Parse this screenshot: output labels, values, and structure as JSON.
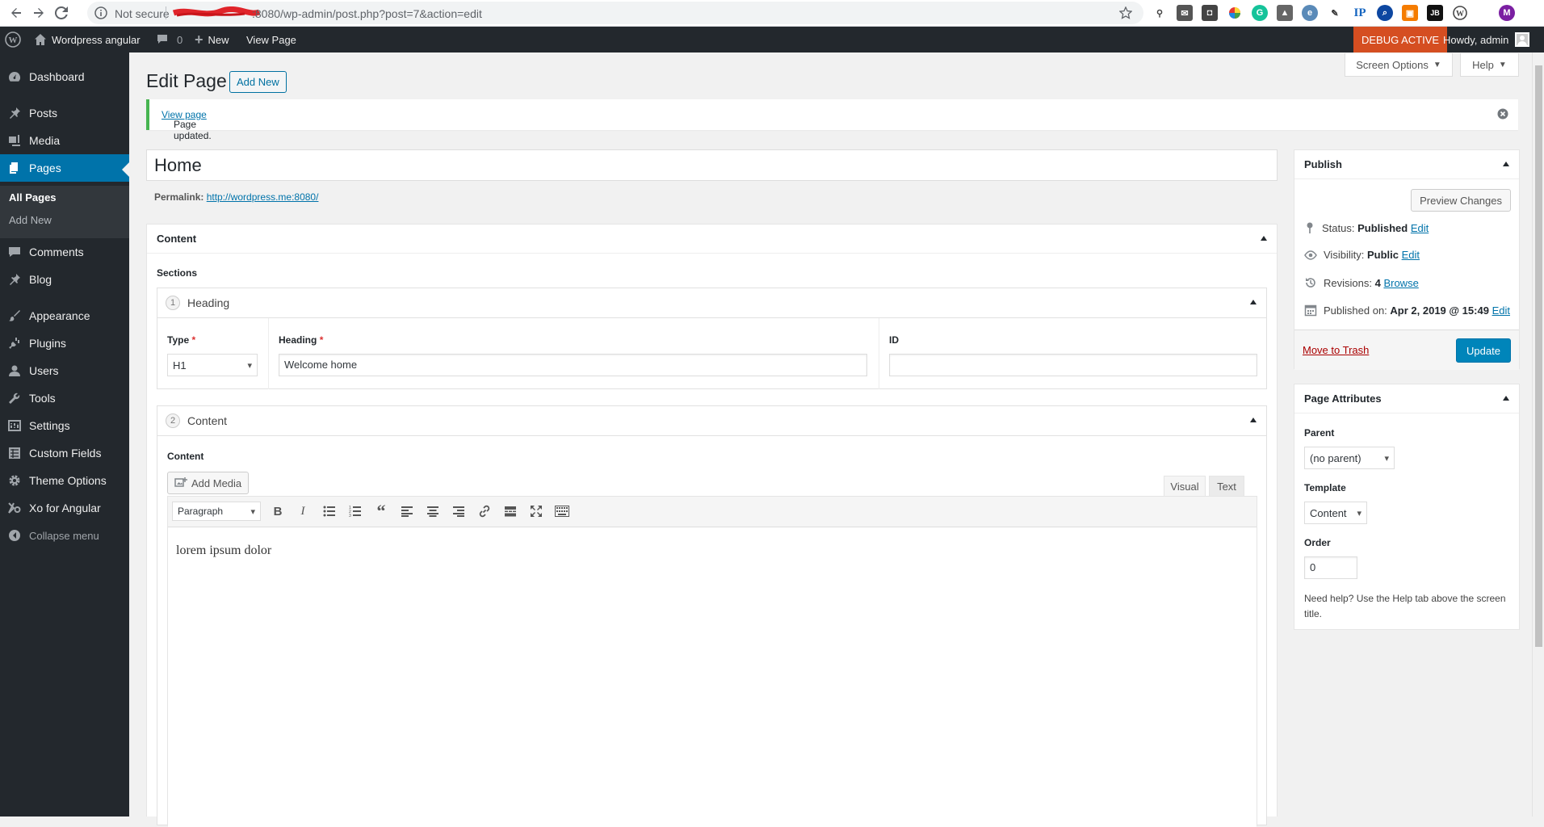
{
  "browser": {
    "not_secure": "Not secure",
    "url_visible": ":8080/wp-admin/post.php?post=7&action=edit",
    "extensions": [
      "key-icon",
      "mail-icon",
      "pocket-icon",
      "color-wheel-icon",
      "grammarly-icon",
      "image-icon",
      "edge-icon",
      "eyedropper-icon",
      "ip-icon",
      "search-icon",
      "bag-icon",
      "jb-icon",
      "wordpress-icon",
      "profile-avatar"
    ],
    "profile_initial": "M"
  },
  "adminbar": {
    "site_name": "Wordpress angular",
    "comments_count": "0",
    "new_label": "New",
    "view_page": "View Page",
    "debug": "DEBUG ACTIVE",
    "howdy": "Howdy, admin"
  },
  "sidebar": {
    "items": [
      {
        "label": "Dashboard",
        "icon": "dashboard-icon"
      },
      {
        "label": "Posts",
        "icon": "pin-icon"
      },
      {
        "label": "Media",
        "icon": "media-icon"
      },
      {
        "label": "Pages",
        "icon": "pages-icon"
      },
      {
        "label": "Comments",
        "icon": "comments-icon"
      },
      {
        "label": "Blog",
        "icon": "pin-icon"
      },
      {
        "label": "Appearance",
        "icon": "brush-icon"
      },
      {
        "label": "Plugins",
        "icon": "plug-icon"
      },
      {
        "label": "Users",
        "icon": "users-icon"
      },
      {
        "label": "Tools",
        "icon": "wrench-icon"
      },
      {
        "label": "Settings",
        "icon": "settings-icon"
      },
      {
        "label": "Custom Fields",
        "icon": "fields-icon"
      },
      {
        "label": "Theme Options",
        "icon": "gear-icon"
      },
      {
        "label": "Xo for Angular",
        "icon": "xo-icon"
      },
      {
        "label": "Collapse menu",
        "icon": "collapse-icon"
      }
    ],
    "sub_items": [
      "All Pages",
      "Add New"
    ]
  },
  "header": {
    "screen_options": "Screen Options",
    "help": "Help",
    "title": "Edit Page",
    "add_new": "Add New"
  },
  "notice": {
    "text": "Page updated.",
    "link": "View page"
  },
  "post": {
    "title": "Home",
    "permalink_label": "Permalink:",
    "permalink_url": "http://wordpress.me:8080/"
  },
  "content_box": {
    "title": "Content",
    "sections_label": "Sections",
    "layouts": [
      {
        "num": "1",
        "name": "Heading"
      },
      {
        "num": "2",
        "name": "Content"
      }
    ],
    "heading_fields": {
      "type_label": "Type",
      "type_value": "H1",
      "heading_label": "Heading",
      "heading_value": "Welcome home",
      "id_label": "ID",
      "id_value": ""
    },
    "content_field": {
      "label": "Content",
      "add_media": "Add Media",
      "tab_visual": "Visual",
      "tab_text": "Text",
      "format": "Paragraph",
      "body": "lorem ipsum dolor"
    }
  },
  "publish": {
    "title": "Publish",
    "preview": "Preview Changes",
    "status_label": "Status:",
    "status_value": "Published",
    "visibility_label": "Visibility:",
    "visibility_value": "Public",
    "revisions_label": "Revisions:",
    "revisions_value": "4",
    "browse": "Browse",
    "published_label": "Published on:",
    "published_value": "Apr 2, 2019 @ 15:49",
    "edit": "Edit",
    "trash": "Move to Trash",
    "update": "Update"
  },
  "attributes": {
    "title": "Page Attributes",
    "parent_label": "Parent",
    "parent_value": "(no parent)",
    "template_label": "Template",
    "template_value": "Content",
    "order_label": "Order",
    "order_value": "0",
    "help_text": "Need help? Use the Help tab above the screen title."
  },
  "colors": {
    "accent": "#0073aa",
    "sidebar": "#23282d",
    "debug": "#d54e21",
    "success": "#46b450"
  }
}
